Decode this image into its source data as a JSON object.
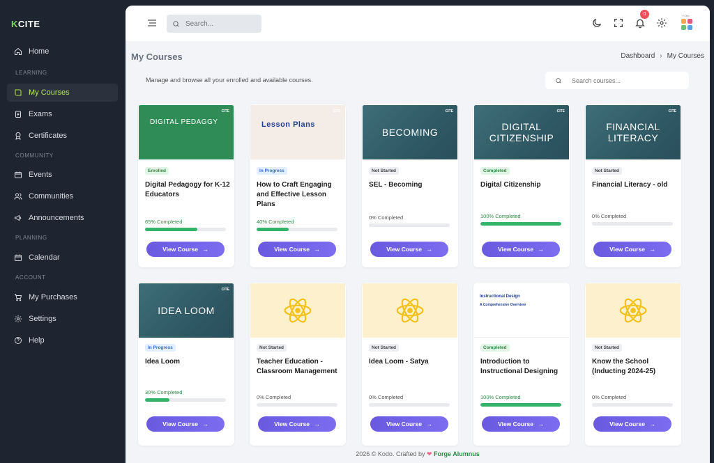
{
  "logo": {
    "mark": "K",
    "text": "CITE"
  },
  "sidebar": {
    "items": [
      {
        "label": "Home",
        "icon": "home-icon"
      },
      {
        "section": "LEARNING"
      },
      {
        "label": "My Courses",
        "icon": "book-icon",
        "active": true
      },
      {
        "label": "Exams",
        "icon": "clipboard-icon"
      },
      {
        "label": "Certificates",
        "icon": "award-icon"
      },
      {
        "section": "COMMUNITY"
      },
      {
        "label": "Events",
        "icon": "calendar-icon"
      },
      {
        "label": "Communities",
        "icon": "users-icon"
      },
      {
        "label": "Announcements",
        "icon": "megaphone-icon"
      },
      {
        "section": "PLANNING"
      },
      {
        "label": "Calendar",
        "icon": "calendar-icon"
      },
      {
        "section": "ACCOUNT"
      },
      {
        "label": "My Purchases",
        "icon": "cart-icon"
      },
      {
        "label": "Settings",
        "icon": "gear-icon"
      },
      {
        "label": "Help",
        "icon": "help-icon"
      }
    ]
  },
  "topbar": {
    "search_placeholder": "Search...",
    "notification_count": "0",
    "app_label": "FOlio"
  },
  "page": {
    "title": "My Courses",
    "breadcrumb": [
      "Dashboard",
      "My Courses"
    ],
    "breadcrumb_sep": "›",
    "subtitle": "Manage and browse all your enrolled and available courses.",
    "course_search_placeholder": "Search courses..."
  },
  "courses": [
    {
      "thumb": "DIGITAL PEDAGGY",
      "thumb_style": "green",
      "status": "Enrolled",
      "title": "Digital Pedagogy for K-12 Educators",
      "progress": 65,
      "progress_label": "65% Completed",
      "button": "View Course"
    },
    {
      "thumb": "Lesson Plans",
      "thumb_style": "lesson",
      "status": "In Progress",
      "title": "How to Craft Engaging and Effective Lesson Plans",
      "progress": 40,
      "progress_label": "40% Completed",
      "button": "View Course"
    },
    {
      "thumb": "BECOMING",
      "thumb_style": "teal",
      "status": "Not Started",
      "title": "SEL - Becoming",
      "progress": 0,
      "progress_label": "0% Completed",
      "button": "View Course"
    },
    {
      "thumb": "DIGITAL CITIZENSHIP",
      "thumb_style": "teal",
      "status": "Completed",
      "title": "Digital Citizenship",
      "progress": 100,
      "progress_label": "100% Completed",
      "button": "View Course"
    },
    {
      "thumb": "FINANCIAL LITERACY",
      "thumb_style": "teal",
      "status": "Not Started",
      "title": "Financial Literacy - old",
      "progress": 0,
      "progress_label": "0% Completed",
      "button": "View Course"
    },
    {
      "thumb": "IDEA LOOM",
      "thumb_style": "teal",
      "status": "In Progress",
      "title": "Idea Loom",
      "progress": 30,
      "progress_label": "30% Completed",
      "button": "View Course"
    },
    {
      "thumb": "",
      "thumb_style": "cream",
      "status": "Not Started",
      "title": "Teacher Education - Classroom Management",
      "progress": 0,
      "progress_label": "0% Completed",
      "button": "View Course"
    },
    {
      "thumb": "",
      "thumb_style": "cream",
      "status": "Not Started",
      "title": "Idea Loom - Satya",
      "progress": 0,
      "progress_label": "0% Completed",
      "button": "View Course"
    },
    {
      "thumb": "Instructional Design",
      "thumb_sub": "A Comprehensive Overview",
      "thumb_style": "white",
      "status": "Completed",
      "title": "Introduction to Instructional Designing",
      "progress": 100,
      "progress_label": "100% Completed",
      "button": "View Course"
    },
    {
      "thumb": "",
      "thumb_style": "cream",
      "status": "Not Started",
      "title": "Know the School (Inducting 2024-25)",
      "progress": 0,
      "progress_label": "0% Completed",
      "button": "View Course"
    }
  ],
  "footer": {
    "text": "2026 © Kodo. Crafted by",
    "brand": "Forge Alumnus"
  },
  "colors": {
    "accent": "#6a5ae0",
    "sidebar_bg": "#1e2530",
    "active_text": "#b5e853",
    "success": "#34b36a"
  }
}
